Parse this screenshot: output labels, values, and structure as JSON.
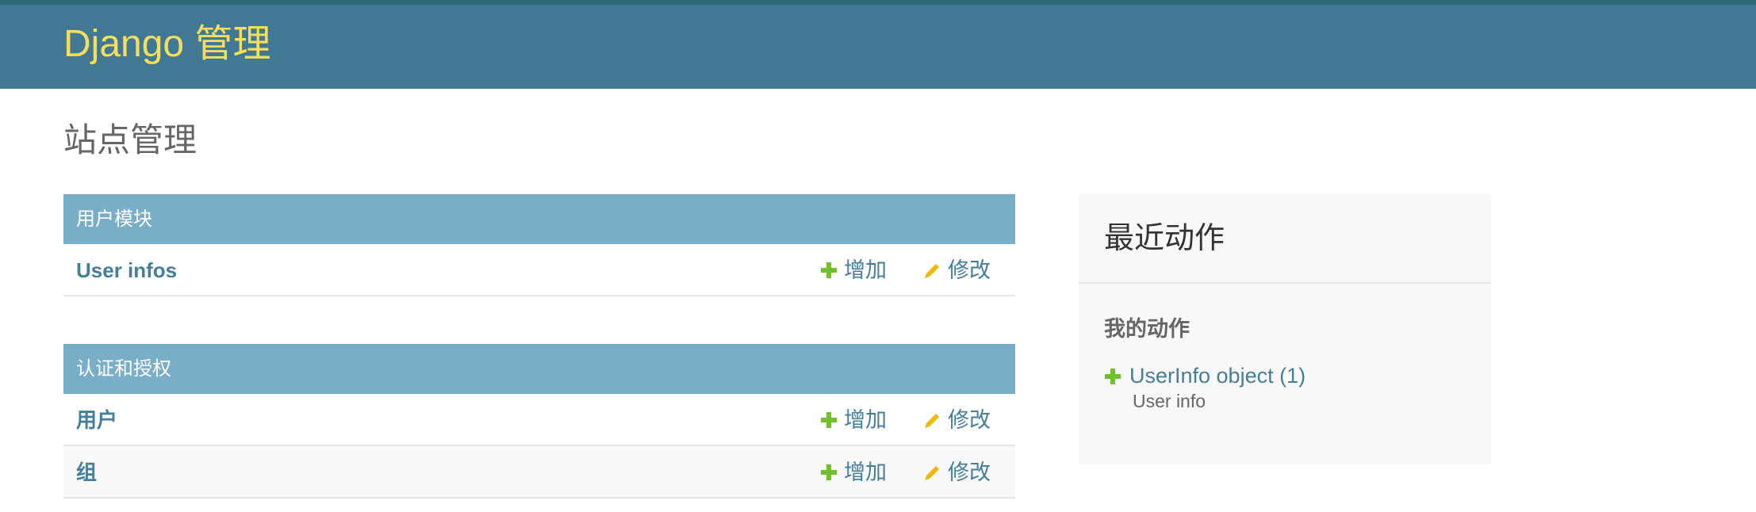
{
  "header": {
    "brand": "Django 管理"
  },
  "main": {
    "title": "站点管理"
  },
  "modules": [
    {
      "caption": "用户模块",
      "rows": [
        {
          "name": "User infos",
          "add": "增加",
          "change": "修改"
        }
      ]
    },
    {
      "caption": "认证和授权",
      "rows": [
        {
          "name": "用户",
          "add": "增加",
          "change": "修改"
        },
        {
          "name": "组",
          "add": "增加",
          "change": "修改"
        }
      ]
    }
  ],
  "recent": {
    "title": "最近动作",
    "subtitle": "我的动作",
    "items": [
      {
        "label": "UserInfo object (1)",
        "type": "User info",
        "icon": "plus-icon"
      }
    ]
  },
  "colors": {
    "header_bg": "#417893",
    "brand": "#f5dd5d",
    "caption_bg": "#79aec8",
    "link": "#447e9b",
    "add_icon": "#70bf2b",
    "change_icon": "#efb80b"
  }
}
